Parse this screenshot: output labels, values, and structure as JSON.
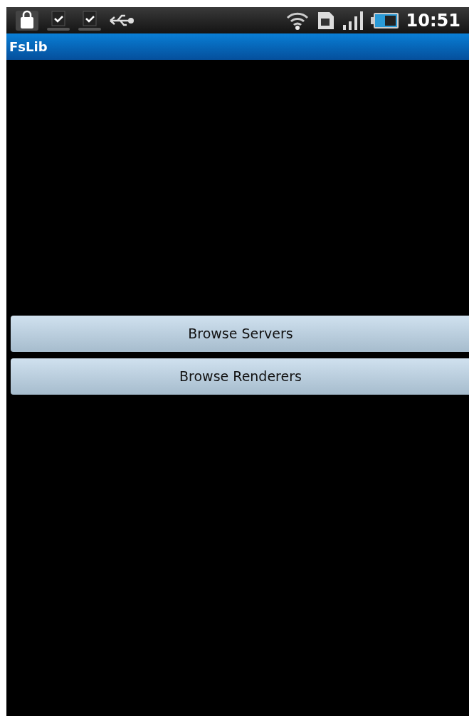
{
  "status_bar": {
    "time": "10:51"
  },
  "app_bar": {
    "title": "FsLib"
  },
  "buttons": [
    {
      "label": "Browse Servers"
    },
    {
      "label": "Browse Renderers"
    }
  ]
}
